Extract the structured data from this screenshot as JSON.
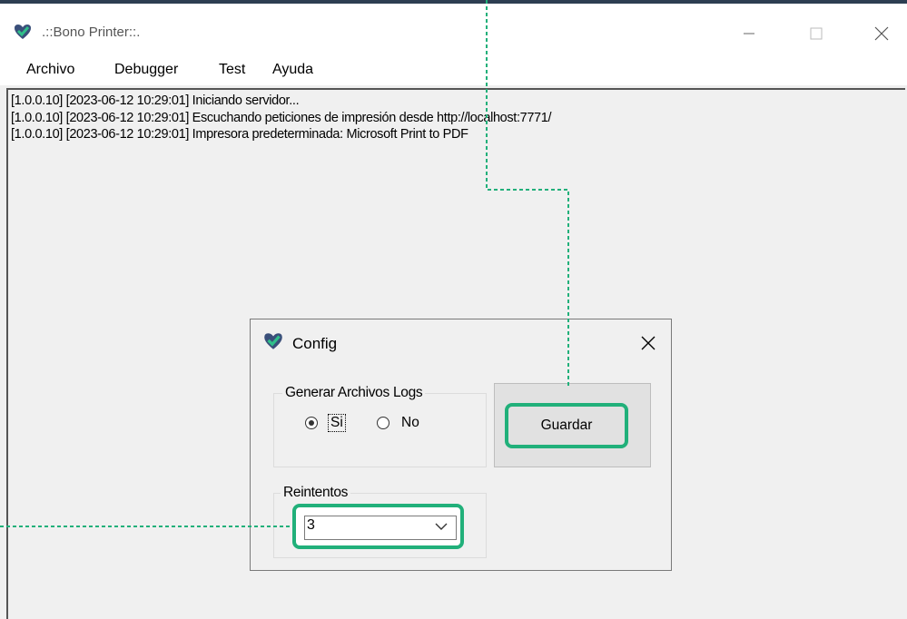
{
  "window": {
    "title": ".::Bono Printer::.",
    "controls": [
      "minimize",
      "maximize",
      "close"
    ]
  },
  "menu": {
    "items": [
      "Archivo",
      "Debugger",
      "Test",
      "Ayuda"
    ]
  },
  "log": {
    "lines": [
      "[1.0.0.10] [2023-06-12 10:29:01] Iniciando servidor...",
      "[1.0.0.10] [2023-06-12 10:29:01] Escuchando peticiones de impresión desde http://localhost:7771/",
      "[1.0.0.10] [2023-06-12 10:29:01] Impresora predeterminada: Microsoft Print to PDF"
    ]
  },
  "config_dialog": {
    "title": "Config",
    "logs_group": {
      "label": "Generar Archivos Logs",
      "options": [
        {
          "label": "Si",
          "selected": true
        },
        {
          "label": "No",
          "selected": false
        }
      ]
    },
    "retries_group": {
      "label": "Reintentos",
      "value": "3"
    },
    "save_button": "Guardar"
  },
  "colors": {
    "highlight": "#21b07a",
    "logo_blue": "#3a4f7a",
    "logo_green": "#2fbf8a"
  },
  "icons": {
    "app": "heart-check-logo-icon",
    "close": "close-icon",
    "dropdown": "chevron-down-icon"
  }
}
